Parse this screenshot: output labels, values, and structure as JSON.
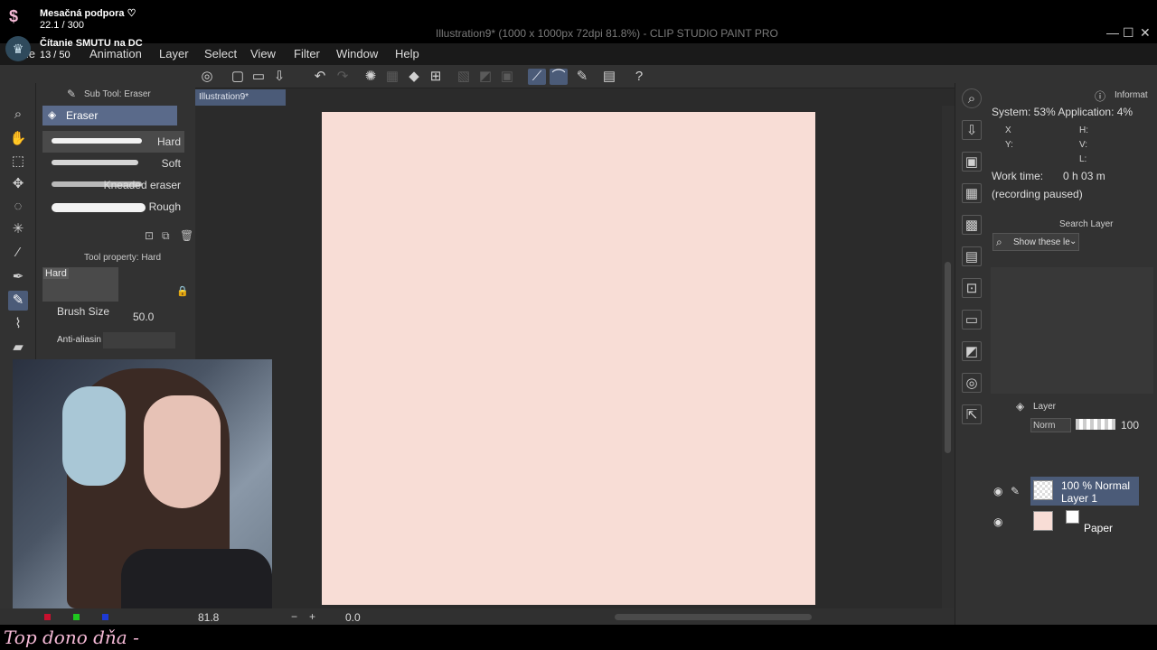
{
  "overlay": {
    "support_label": "Mesačná podpora ♡",
    "support_count": "22.1 / 300",
    "reading_label": "Čítanie SMUTU na DC",
    "reading_count": "13 / 50",
    "bottom_text": "Top dono dňa -"
  },
  "window": {
    "title": "Illustration9* (1000 x 1000px 72dpi 81.8%)  - CLIP STUDIO PAINT PRO"
  },
  "menu": [
    "File",
    "Animation",
    "Layer",
    "Select",
    "View",
    "Filter",
    "Window",
    "Help"
  ],
  "subtool": {
    "panel_title": "Sub Tool: Eraser",
    "group_name": "Eraser",
    "brushes": [
      {
        "label": "Hard",
        "selected": true
      },
      {
        "label": "Soft",
        "selected": false
      },
      {
        "label": "Kneaded eraser",
        "selected": false
      },
      {
        "label": "Rough",
        "selected": false
      }
    ]
  },
  "toolprop": {
    "title": "Tool property: Hard",
    "preview_label": "Hard",
    "brush_size_label": "Brush Size",
    "brush_size_value": "50.0",
    "antialias_label": "Anti-aliasin"
  },
  "document": {
    "tab_label": "Illustration9*"
  },
  "status": {
    "zoom": "81.8",
    "angle": "0.0"
  },
  "info": {
    "tab": "Informat",
    "system": "System: 53% Application:  4%",
    "x_label": "X",
    "y_label": "Y:",
    "h_label": "H:",
    "v_label": "V:",
    "l_label": "L:",
    "work_time_label": "Work time:",
    "work_time_value": "0 h 03 m",
    "recording": "(recording paused)"
  },
  "search_layer": {
    "tab": "Search Layer",
    "dropdown": "Show these le"
  },
  "layer_panel": {
    "tab": "Layer",
    "blend_mode": "Norm",
    "opacity": "100",
    "layers": [
      {
        "line1": "100 % Normal",
        "line2": "Layer 1"
      },
      {
        "line1": "",
        "line2": "Paper"
      }
    ]
  },
  "colors": {
    "paper": "#f8ddd6",
    "accent": "#4b5b78",
    "overlay_pink": "#f5b9d6"
  }
}
